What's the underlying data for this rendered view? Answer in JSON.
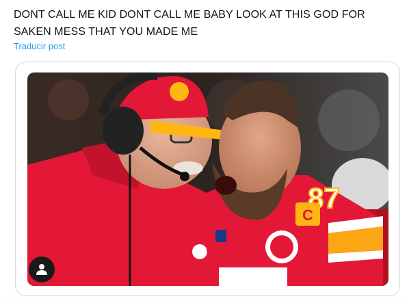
{
  "post": {
    "text": "DONT CALL ME KID DONT CALL ME BABY LOOK AT THIS GOD FOR SAKEN MESS THAT YOU MADE ME",
    "translate_label": "Traducir post"
  },
  "media": {
    "jersey_number": "87",
    "captain_patch": "C",
    "alt_icon": "person-icon"
  },
  "colors": {
    "link": "#1d9bf0",
    "text": "#0f1419",
    "chiefs_red": "#e31837",
    "chiefs_gold": "#ffb612"
  }
}
